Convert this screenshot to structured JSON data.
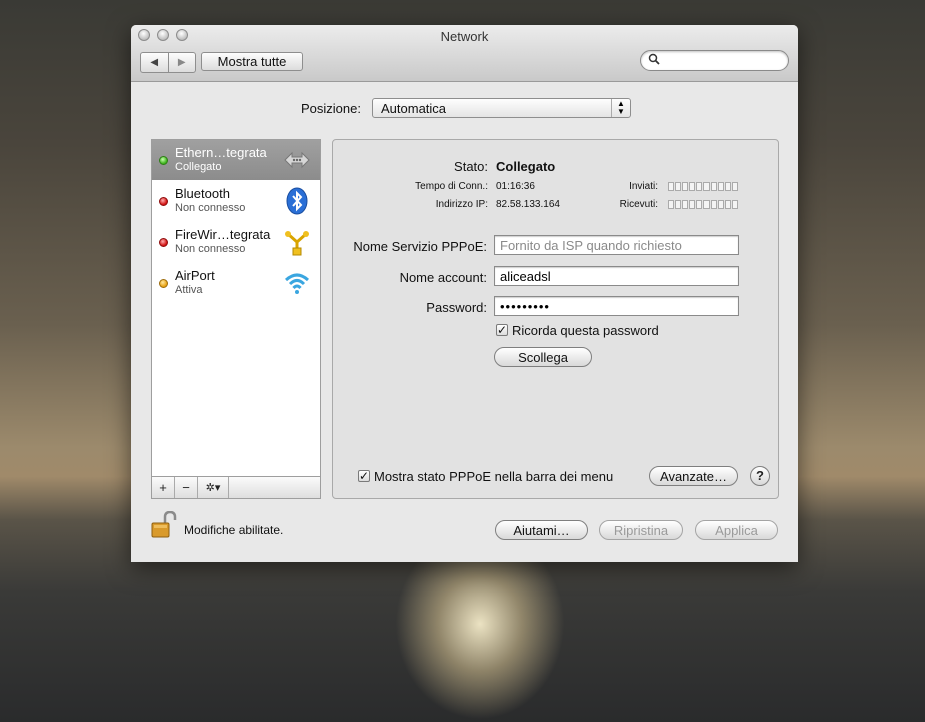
{
  "window": {
    "title": "Network"
  },
  "toolbar": {
    "show_all": "Mostra tutte",
    "search_placeholder": ""
  },
  "location": {
    "label": "Posizione:",
    "value": "Automatica"
  },
  "services": [
    {
      "name": "Ethern…tegrata",
      "status": "Collegato",
      "state": "green"
    },
    {
      "name": "Bluetooth",
      "status": "Non connesso",
      "state": "red"
    },
    {
      "name": "FireWir…tegrata",
      "status": "Non connesso",
      "state": "red"
    },
    {
      "name": "AirPort",
      "status": "Attiva",
      "state": "orange"
    }
  ],
  "sidebar_tools": {
    "add": "+",
    "remove": "−",
    "gear": "✲▾"
  },
  "details": {
    "status_label": "Stato:",
    "status_value": "Collegato",
    "conn_time_label": "Tempo di Conn.:",
    "conn_time_value": "01:16:36",
    "ip_label": "Indirizzo IP:",
    "ip_value": "82.58.133.164",
    "sent_label": "Inviati:",
    "received_label": "Ricevuti:",
    "pppoe_service_label": "Nome Servizio PPPoE:",
    "pppoe_service_placeholder": "Fornito da ISP quando richiesto",
    "account_label": "Nome account:",
    "account_value": "aliceadsl",
    "password_label": "Password:",
    "password_value": "•••••••••",
    "remember_label": "Ricorda questa password",
    "disconnect_button": "Scollega",
    "show_status_label": "Mostra stato PPPoE nella barra dei menu",
    "advanced_button": "Avanzate…",
    "help": "?"
  },
  "footer": {
    "lock_text": "Modifiche abilitate.",
    "help_button": "Aiutami…",
    "revert_button": "Ripristina",
    "apply_button": "Applica"
  }
}
